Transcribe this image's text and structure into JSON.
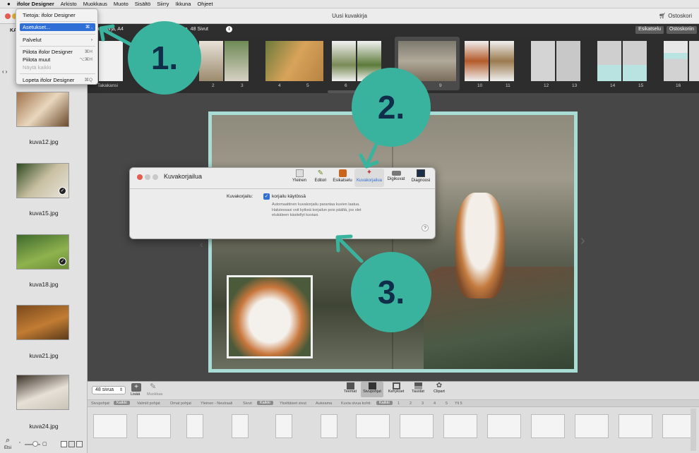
{
  "menubar": {
    "apple": "",
    "app": "ifolor Designer",
    "items": [
      "Arkisto",
      "Muokkaus",
      "Muoto",
      "Sisältö",
      "Siirry",
      "Ikkuna",
      "Ohjeet"
    ]
  },
  "window": {
    "title": "Uusi kuvakirja",
    "cart": "Ostoskori"
  },
  "app_menu": {
    "items": [
      {
        "label": "Tietoja: ifolor Designer",
        "shortcut": ""
      },
      {
        "label": "Asetukset...",
        "shortcut": "⌘ ,"
      },
      {
        "label": "Palvelut",
        "shortcut": "›"
      },
      {
        "label": "Piilota ifolor Designer",
        "shortcut": "⌘H"
      },
      {
        "label": "Piilota muut",
        "shortcut": "⌥⌘H"
      },
      {
        "label": "Näytä kaikki",
        "shortcut": ""
      },
      {
        "label": "Lopeta ifolor Designer",
        "shortcut": "⌘Q"
      }
    ]
  },
  "toolbar": {
    "info": "Kuvakirja, A4",
    "info2": "tta, 48 Sivut",
    "preview": "Esikatselu",
    "cart_btn": "Ostoskoriin"
  },
  "sidebar": {
    "header": "KA",
    "photos": [
      "kuva12.jpg",
      "kuva15.jpg",
      "kuva18.jpg",
      "kuva21.jpg",
      "kuva24.jpg"
    ],
    "checked": [
      false,
      true,
      true,
      false,
      false
    ]
  },
  "filmstrip": {
    "cover_label": "Takakansi",
    "page_numbers": [
      "2",
      "3",
      "4",
      "5",
      "6",
      "7",
      "8",
      "9",
      "10",
      "11",
      "12",
      "13",
      "14",
      "15",
      "16"
    ]
  },
  "dialog": {
    "title": "Kuvakorjailua",
    "tabs": [
      "Yleinen",
      "Editori",
      "Esikatselu",
      "Kuvakorjailua",
      "Digikuvat",
      "Diagnoosi"
    ],
    "active_tab": 3,
    "field_label": "Kuvakorjailu:",
    "checkbox_label": "korjailu käytössä",
    "description": [
      "Automaattinen kuvakorjailu parantaa kuvien laatua.",
      "Halutessasi voit kytkeä korjailun pois päältä, jos olet",
      "etukäteen käsitellyt kuviasi."
    ],
    "help": "?"
  },
  "bottom": {
    "page_count": "48 sivua",
    "add_label": "Lisää",
    "edit_label": "Muokkaa",
    "tools": [
      "Teemat",
      "Sivupohjat",
      "Kehykset",
      "Taustat",
      "Clipart"
    ],
    "active_tool": 1,
    "filter_row": [
      "Sivupohjat:",
      "Kaikki",
      "Valmiit pohjat",
      "Omat pohjat",
      "Yleinen - Neutraali",
      "Sivut:",
      "Kaikki",
      "Yksittäiset sivut",
      "Aukeama",
      "Kuvia sivua kohti:",
      "Kaikki",
      "1",
      "2",
      "3",
      "4",
      "5",
      "Yli 5"
    ]
  },
  "statusbar": {
    "search": "Etsi"
  },
  "callouts": [
    "1.",
    "2.",
    "3."
  ],
  "colors": {
    "accent": "#3ab39e",
    "callout_text": "#0e2e4a",
    "selection": "#2f6fd6"
  }
}
